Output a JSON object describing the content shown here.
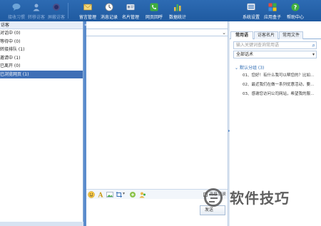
{
  "toolbar": {
    "left_buttons": [
      {
        "label": "接收习惯",
        "icon": "bubble-icon",
        "dim": true
      },
      {
        "label": "转移访客",
        "icon": "person-icon",
        "dim": true
      },
      {
        "label": "屏蔽访客",
        "icon": "block-icon",
        "dim": true
      },
      {
        "label": "留言管理",
        "icon": "envelope-icon",
        "dim": false
      },
      {
        "label": "消息记录",
        "icon": "clock-icon",
        "dim": false
      },
      {
        "label": "名片管理",
        "icon": "card-icon",
        "dim": false
      },
      {
        "label": "网页回呼",
        "icon": "phone-icon",
        "dim": false
      },
      {
        "label": "数据统计",
        "icon": "bar-chart-icon",
        "dim": false
      }
    ],
    "right_buttons": [
      {
        "label": "系统设置",
        "icon": "settings-icon"
      },
      {
        "label": "应用盒子",
        "icon": "grid-icon"
      },
      {
        "label": "帮助中心",
        "icon": "help-icon"
      }
    ]
  },
  "left_panel": {
    "header": "访客",
    "items": [
      {
        "label": "对话中 (0)",
        "selected": false
      },
      {
        "label": "等待中 (0)",
        "selected": false
      },
      {
        "label": "转接排队 (1)",
        "selected": false
      },
      {
        "label": "邀请中 (1)",
        "selected": false
      },
      {
        "label": "已离开 (0)",
        "selected": false
      },
      {
        "label": "已浏览网页 (1)",
        "selected": true
      }
    ]
  },
  "center": {
    "collapse_glyph": "«",
    "history_label": "消息记录",
    "send_label": "发送"
  },
  "right_panel": {
    "tabs": [
      "常用语",
      "访客名片",
      "常用文件"
    ],
    "active_tab": 0,
    "search_placeholder": "输入关键词查询常用语",
    "select_value": "全部话术",
    "group_label": "默认分组 (3)",
    "phrases": [
      "01、您好！有什么我可以帮您的？比如...",
      "02、最近我们在做一系列优惠活动，要...",
      "03、感谢您访问公司网站，希望我的服..."
    ]
  },
  "watermark": "软件技巧",
  "colors": {
    "toolbar": "#2d6bb3",
    "selection": "#3f6fb6",
    "border": "#8fb0d8"
  }
}
